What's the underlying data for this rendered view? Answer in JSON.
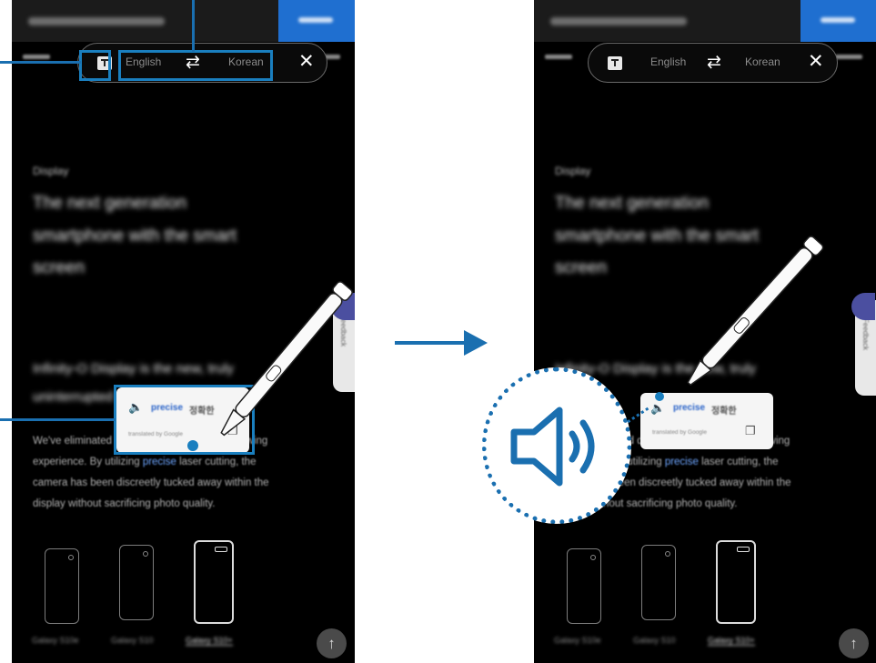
{
  "translator_bar": {
    "source_language": "English",
    "target_language": "Korean",
    "swap_symbol": "⇄",
    "close_symbol": "✕"
  },
  "tooltip": {
    "speaker_symbol": "🔈"
  },
  "scroll_top_symbol": "↑",
  "icons": [
    "translate-mode-icon",
    "swap-languages-icon",
    "close-icon",
    "speaker-icon",
    "copy-icon",
    "scroll-to-top-icon",
    "s-pen",
    "flow-arrow"
  ],
  "colors": {
    "accent": "#1a6fb0",
    "highlight_box": "#1a7fbf",
    "buy_button": "#1f6fd0",
    "phone_background": "#000000"
  }
}
